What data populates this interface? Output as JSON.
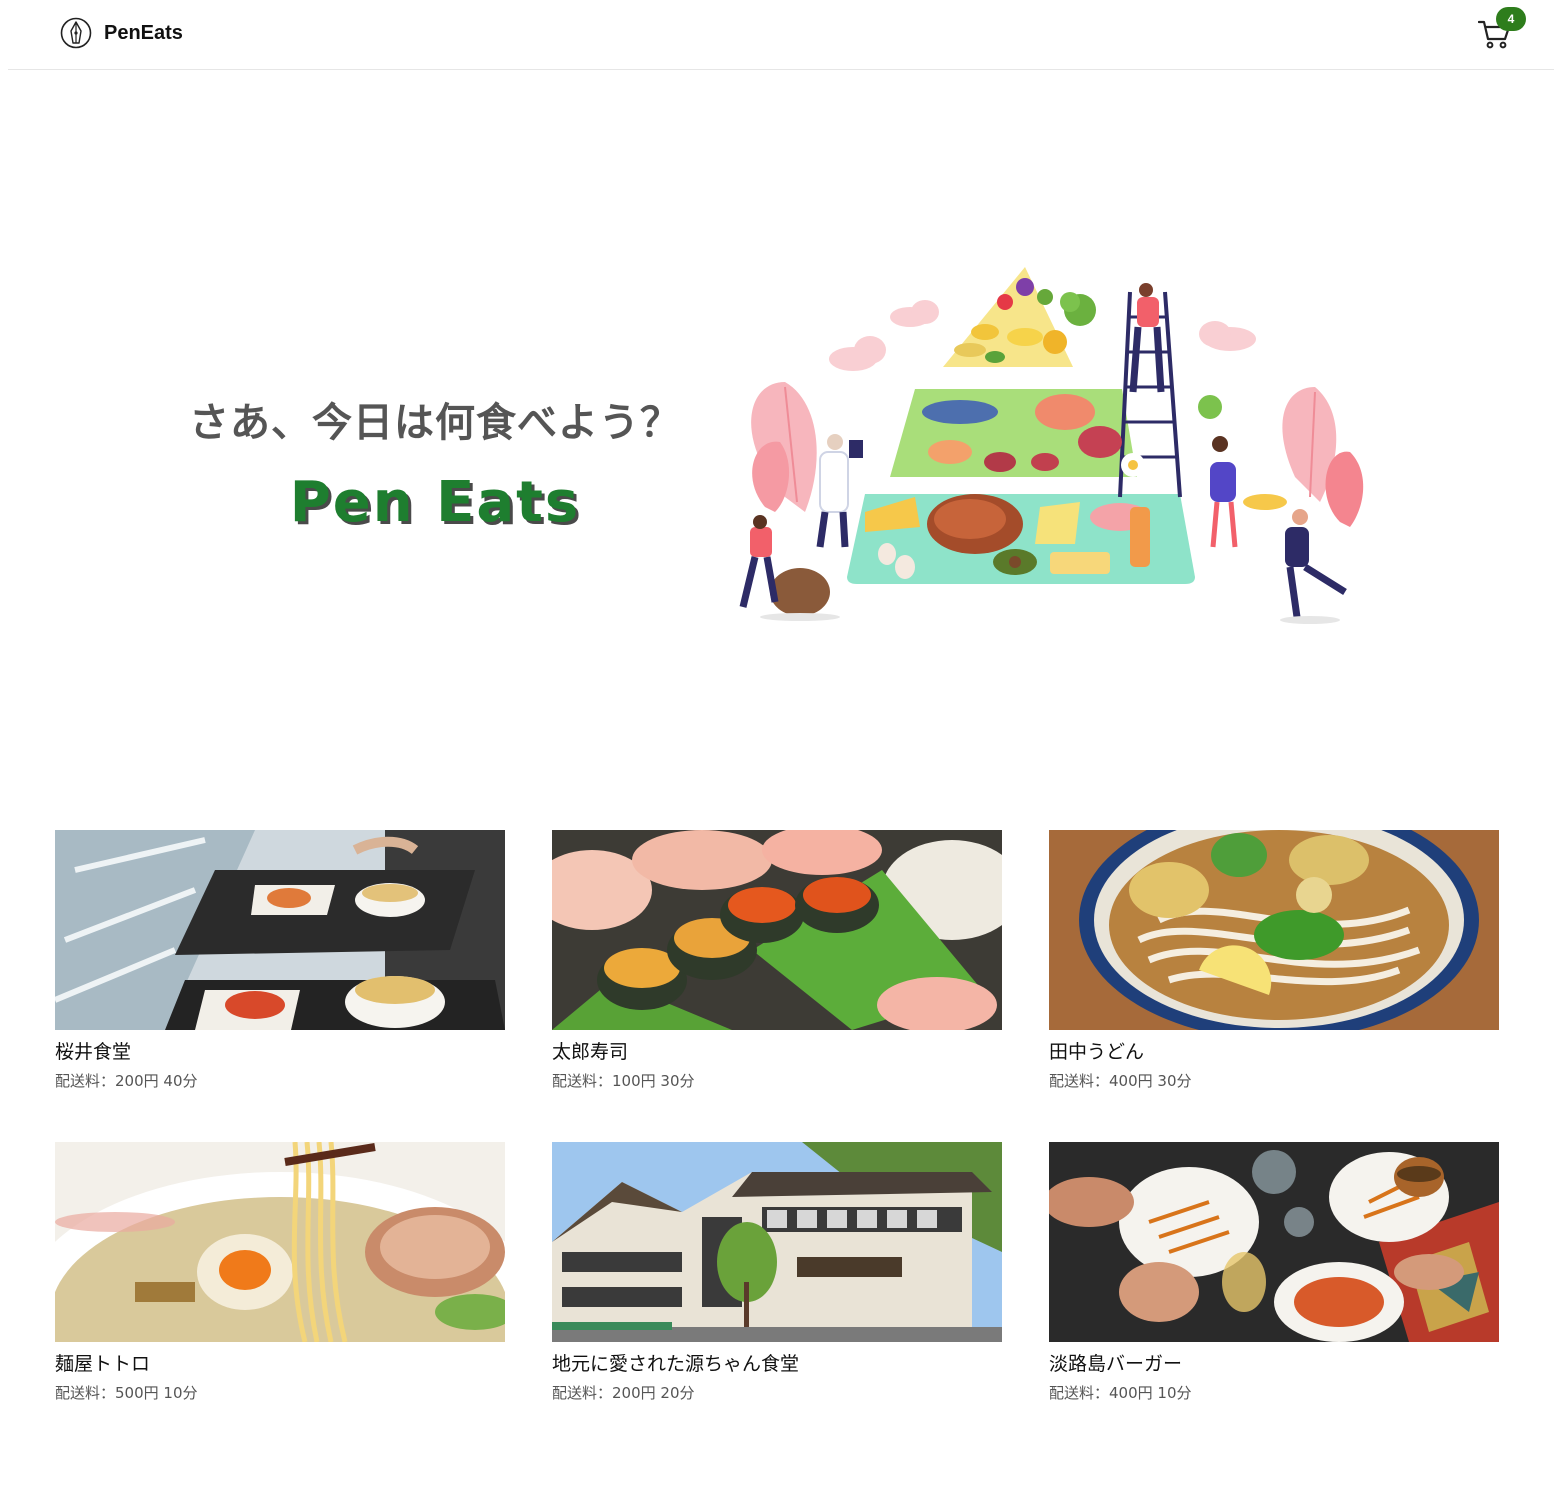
{
  "header": {
    "brand_name": "PenEats",
    "logo_icon": "fountain-pen-nib-icon",
    "cart_icon": "shopping-cart-icon",
    "cart_count": "4",
    "badge_color": "#2e7d1c"
  },
  "hero": {
    "title": "さあ、今日は何食べよう？",
    "brand": "Pen Eats",
    "brand_color": "#1e7e2f",
    "illustration": "food-pyramid-illustration"
  },
  "restaurants": [
    {
      "name": "桜井食堂",
      "meta": "配送料：200円 40分",
      "photo": "cafeteria-trays-photo"
    },
    {
      "name": "太郎寿司",
      "meta": "配送料：100円 30分",
      "photo": "sushi-platter-photo"
    },
    {
      "name": "田中うどん",
      "meta": "配送料：400円 30分",
      "photo": "udon-bowl-photo"
    },
    {
      "name": "麺屋トトロ",
      "meta": "配送料：500円 10分",
      "photo": "ramen-bowl-photo"
    },
    {
      "name": "地元に愛された源ちゃん食堂",
      "meta": "配送料：200円 20分",
      "photo": "restaurant-building-photo"
    },
    {
      "name": "淡路島バーガー",
      "meta": "配送料：400円 10分",
      "photo": "burger-table-photo"
    }
  ]
}
